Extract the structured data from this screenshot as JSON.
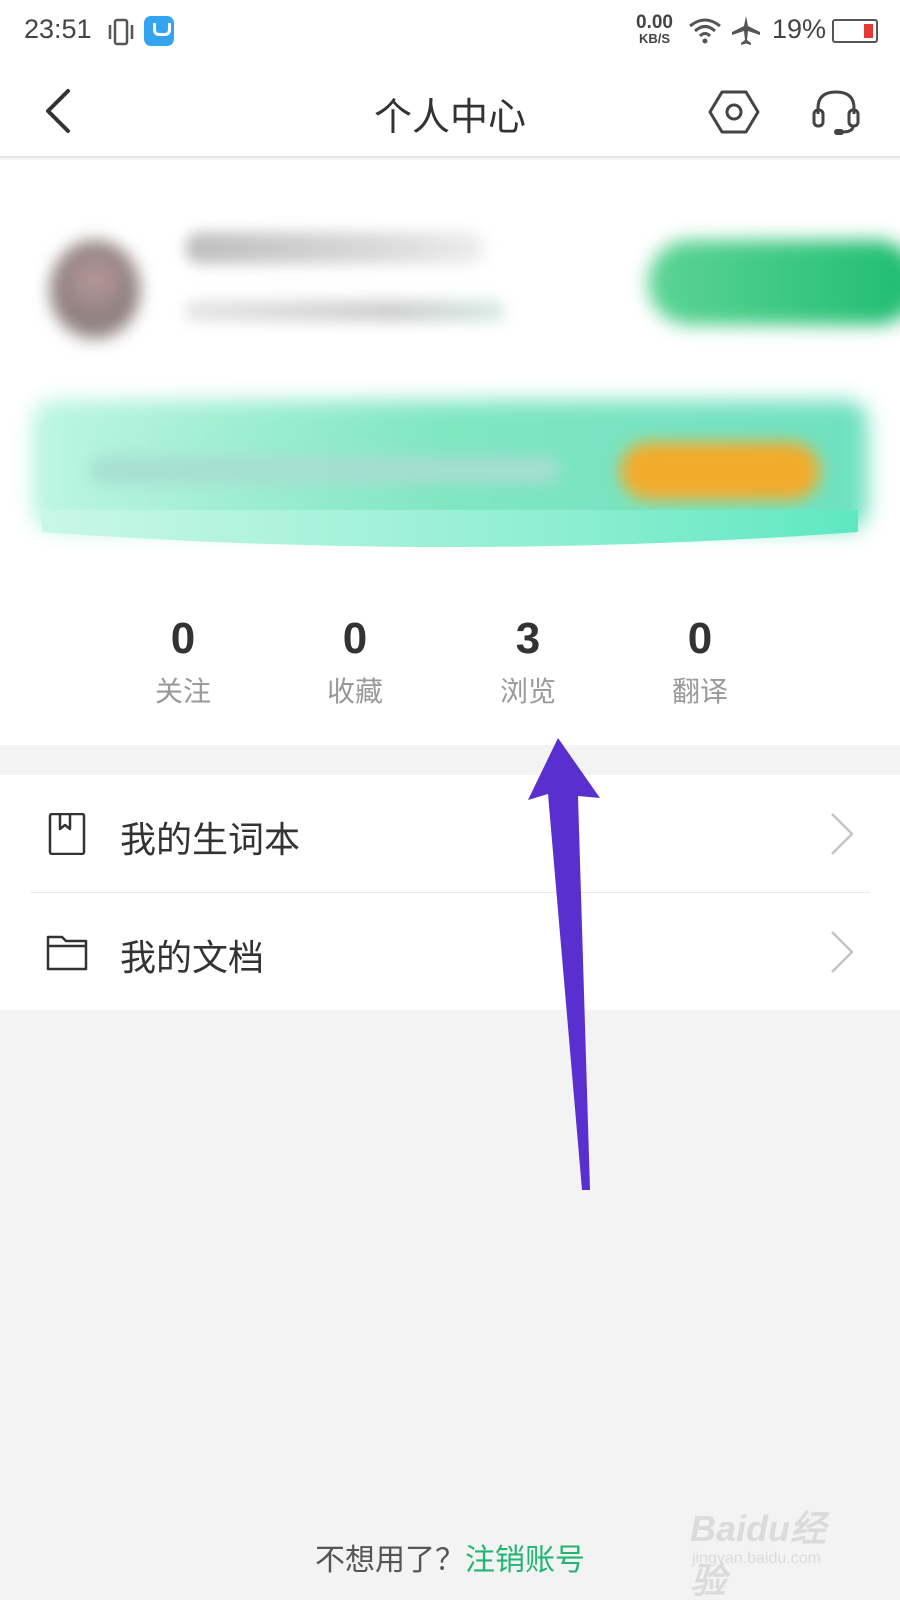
{
  "status_bar": {
    "time": "23:51",
    "net_speed_value": "0.00",
    "net_speed_unit": "KB/S",
    "battery": "19%"
  },
  "header": {
    "title": "个人中心",
    "icons": [
      "back-icon",
      "settings-icon",
      "headset-icon"
    ]
  },
  "stats": [
    {
      "value": "0",
      "label": "关注"
    },
    {
      "value": "0",
      "label": "收藏"
    },
    {
      "value": "3",
      "label": "浏览"
    },
    {
      "value": "0",
      "label": "翻译"
    }
  ],
  "menu": [
    {
      "label": "我的生词本",
      "icon": "bookmark-book-icon"
    },
    {
      "label": "我的文档",
      "icon": "folder-icon"
    }
  ],
  "footer": {
    "question": "不想用了？",
    "link": "注销账号"
  },
  "watermark": {
    "main": "Baidu经验",
    "sub": "jingyan.baidu.com"
  },
  "colors": {
    "accent_green": "#21b574",
    "arrow_purple": "#5a2fd0",
    "banner_orange": "#f3ab2b"
  }
}
